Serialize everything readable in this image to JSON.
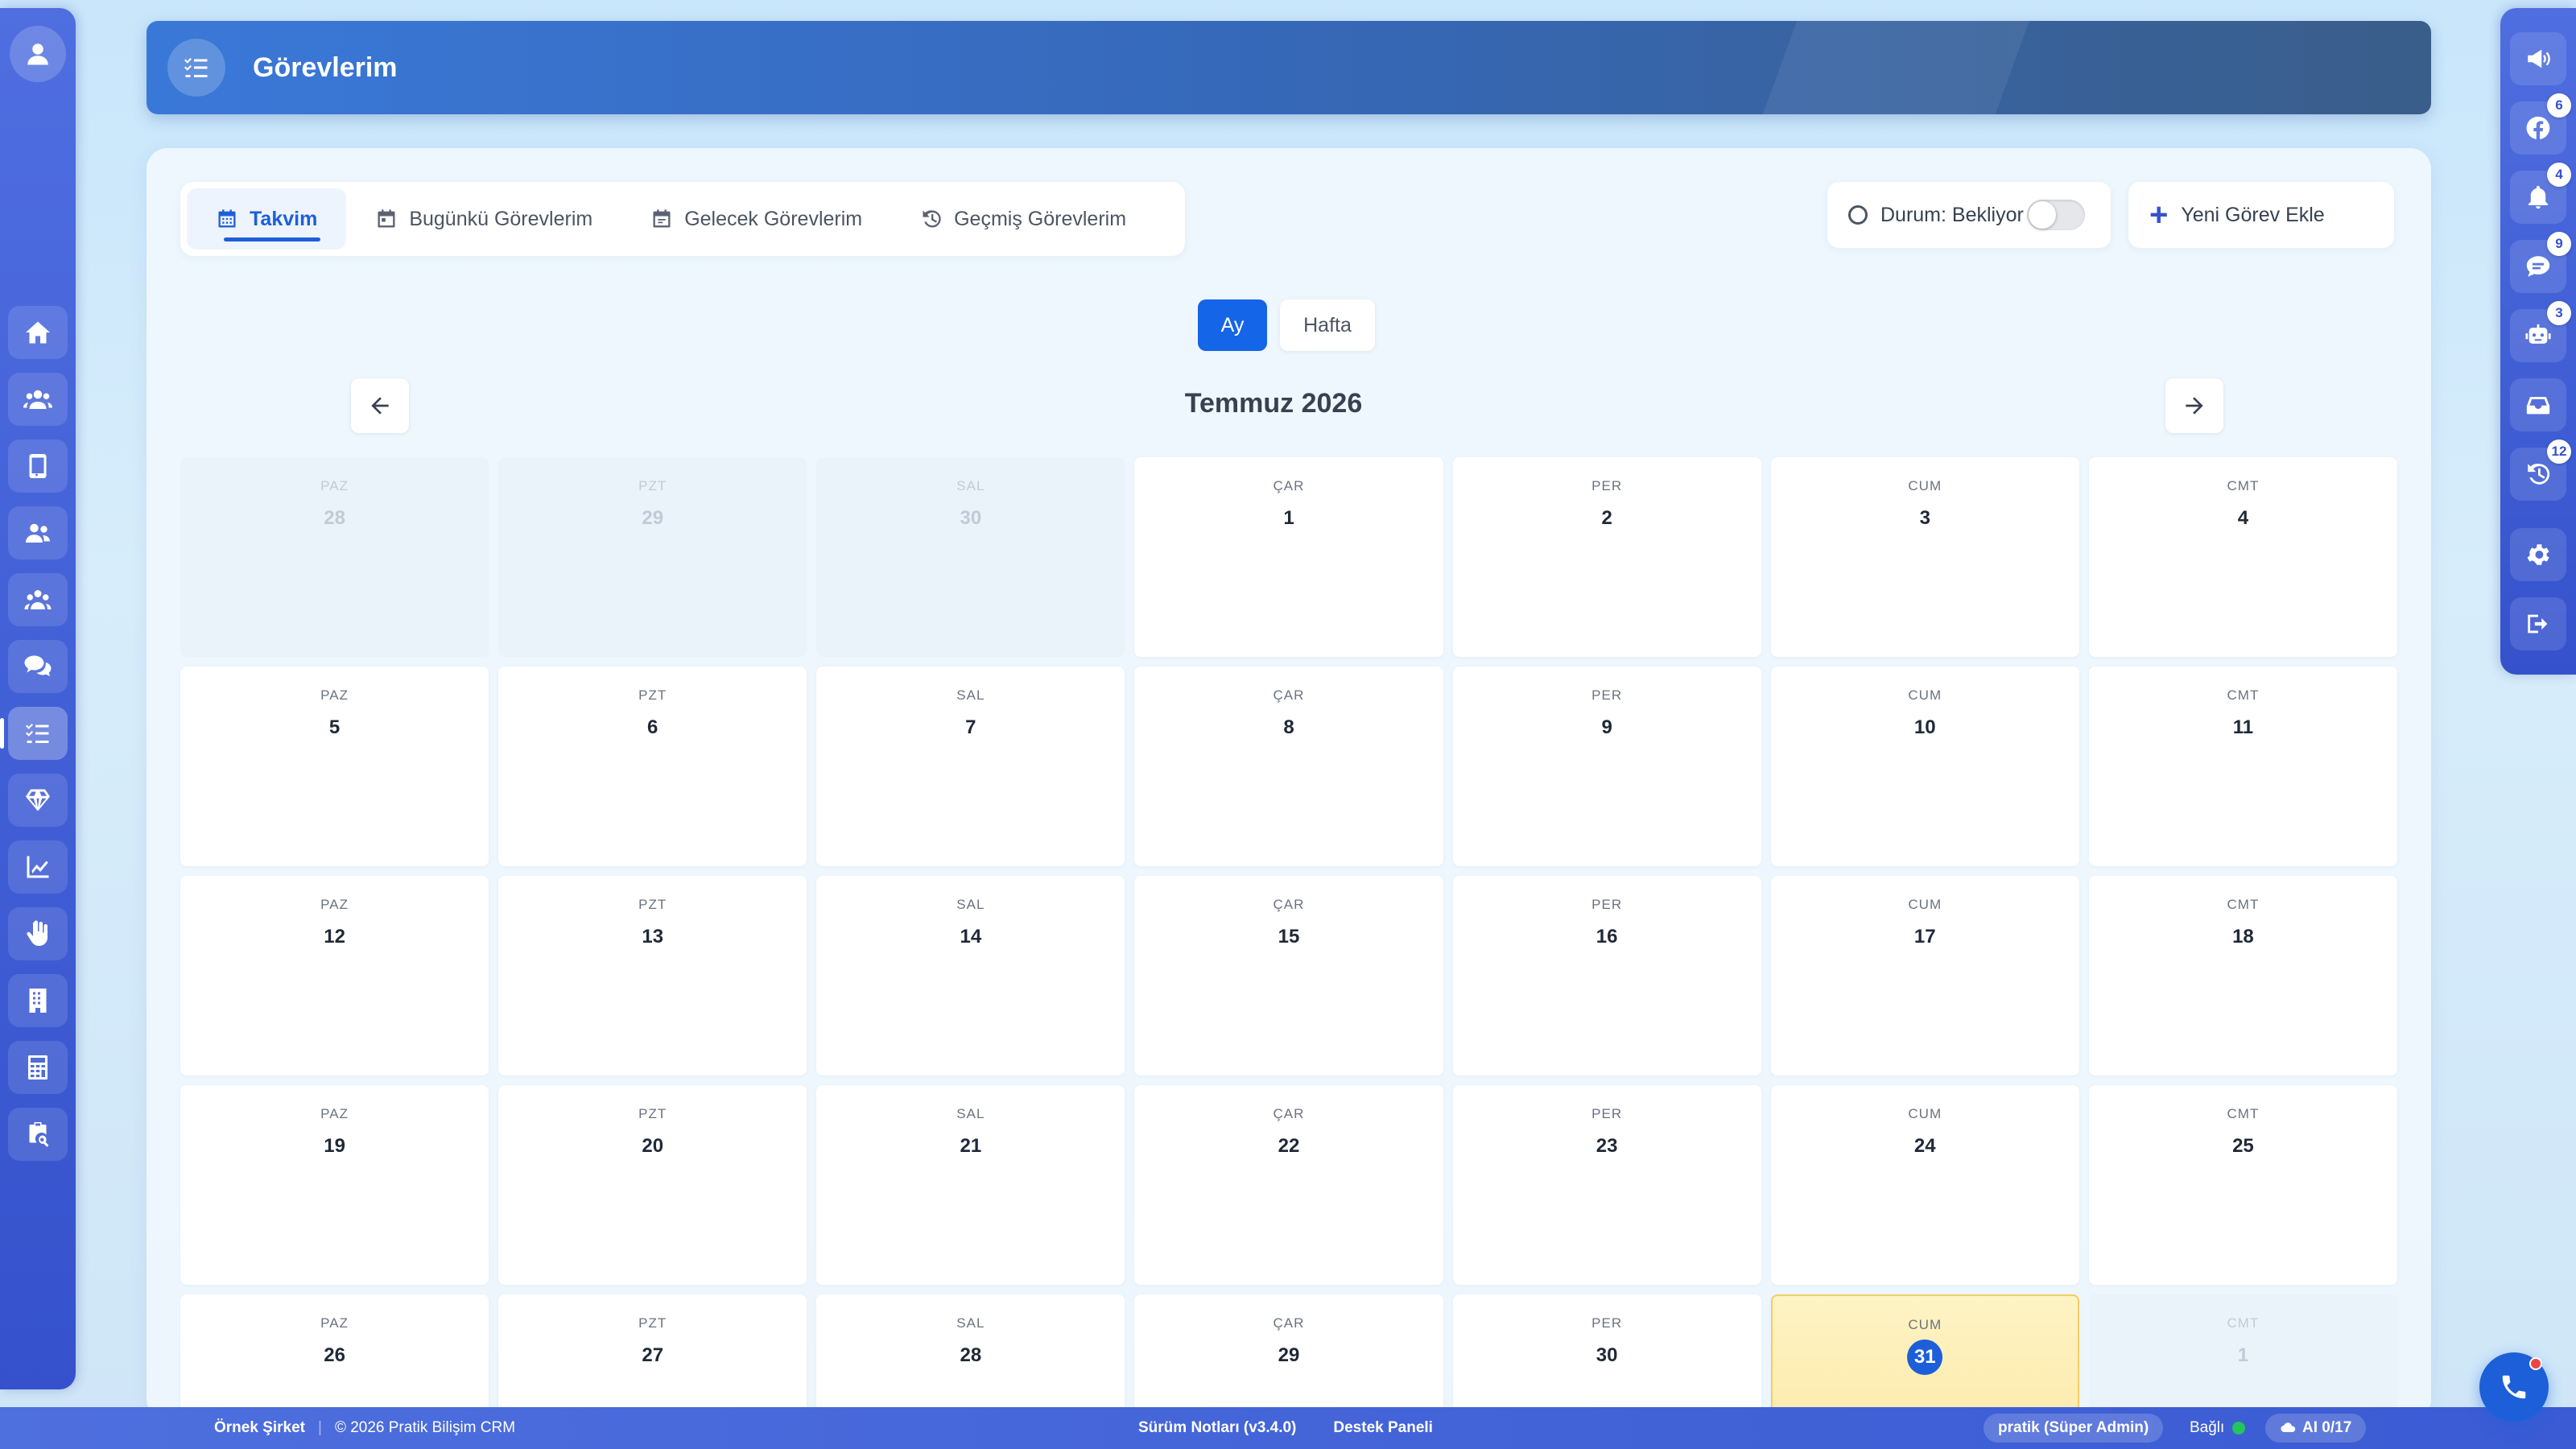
{
  "header": {
    "title": "Görevlerim"
  },
  "tabs": [
    {
      "label": "Takvim",
      "icon": "calendar-icon",
      "active": true
    },
    {
      "label": "Bugünkü Görevlerim",
      "icon": "calendar-day-icon"
    },
    {
      "label": "Gelecek Görevlerim",
      "icon": "calendar-future-icon"
    },
    {
      "label": "Geçmiş Görevlerim",
      "icon": "history-icon"
    }
  ],
  "status": {
    "label": "Durum: Bekliyor"
  },
  "add_task": {
    "label": "Yeni Görev Ekle"
  },
  "view": {
    "month": "Ay",
    "week": "Hafta",
    "selected": "Ay"
  },
  "calendar": {
    "title": "Temmuz 2026",
    "rows": [
      [
        {
          "dow": "PAZ",
          "day": "28",
          "muted": true
        },
        {
          "dow": "PZT",
          "day": "29",
          "muted": true
        },
        {
          "dow": "SAL",
          "day": "30",
          "muted": true
        },
        {
          "dow": "ÇAR",
          "day": "1"
        },
        {
          "dow": "PER",
          "day": "2"
        },
        {
          "dow": "CUM",
          "day": "3"
        },
        {
          "dow": "CMT",
          "day": "4"
        }
      ],
      [
        {
          "dow": "PAZ",
          "day": "5"
        },
        {
          "dow": "PZT",
          "day": "6"
        },
        {
          "dow": "SAL",
          "day": "7"
        },
        {
          "dow": "ÇAR",
          "day": "8"
        },
        {
          "dow": "PER",
          "day": "9"
        },
        {
          "dow": "CUM",
          "day": "10"
        },
        {
          "dow": "CMT",
          "day": "11"
        }
      ],
      [
        {
          "dow": "PAZ",
          "day": "12"
        },
        {
          "dow": "PZT",
          "day": "13"
        },
        {
          "dow": "SAL",
          "day": "14"
        },
        {
          "dow": "ÇAR",
          "day": "15"
        },
        {
          "dow": "PER",
          "day": "16"
        },
        {
          "dow": "CUM",
          "day": "17"
        },
        {
          "dow": "CMT",
          "day": "18"
        }
      ],
      [
        {
          "dow": "PAZ",
          "day": "19"
        },
        {
          "dow": "PZT",
          "day": "20"
        },
        {
          "dow": "SAL",
          "day": "21"
        },
        {
          "dow": "ÇAR",
          "day": "22"
        },
        {
          "dow": "PER",
          "day": "23"
        },
        {
          "dow": "CUM",
          "day": "24"
        },
        {
          "dow": "CMT",
          "day": "25"
        }
      ],
      [
        {
          "dow": "PAZ",
          "day": "26"
        },
        {
          "dow": "PZT",
          "day": "27"
        },
        {
          "dow": "SAL",
          "day": "28"
        },
        {
          "dow": "ÇAR",
          "day": "29"
        },
        {
          "dow": "PER",
          "day": "30"
        },
        {
          "dow": "CUM",
          "day": "31",
          "today": true
        },
        {
          "dow": "CMT",
          "day": "1",
          "muted": true
        }
      ]
    ]
  },
  "left_sidebar": {
    "items": [
      "home-icon",
      "users-icon",
      "mobile-icon",
      "user-group-icon",
      "team-icon",
      "chat-icon",
      "tasks-icon",
      "diamond-icon",
      "chart-line-icon",
      "hand-icon",
      "building-icon",
      "calculator-icon",
      "clipboard-search-icon"
    ],
    "active": "tasks-icon"
  },
  "right_sidebar": {
    "items": [
      {
        "icon": "megaphone-icon",
        "badge": ""
      },
      {
        "icon": "facebook-icon",
        "badge": "6"
      },
      {
        "icon": "bell-icon",
        "badge": "4"
      },
      {
        "icon": "message-icon",
        "badge": "9"
      },
      {
        "icon": "robot-icon",
        "badge": "3"
      },
      {
        "icon": "inbox-icon",
        "badge": ""
      },
      {
        "icon": "history-icon",
        "badge": "12"
      }
    ],
    "bottom": [
      "gear-icon",
      "logout-icon"
    ]
  },
  "footer": {
    "company": "Örnek Şirket",
    "copyright": "© 2026 Pratik Bilişim CRM",
    "release_notes": "Sürüm Notları (v3.4.0)",
    "support": "Destek Paneli",
    "user": "pratik (Süper Admin)",
    "connection": "Bağlı",
    "ai": "AI 0/17"
  },
  "colors": {
    "accent": "#1d5fd9",
    "sidebar": "#3552cc",
    "today": "#fde7a1",
    "connected": "#22c55e"
  }
}
